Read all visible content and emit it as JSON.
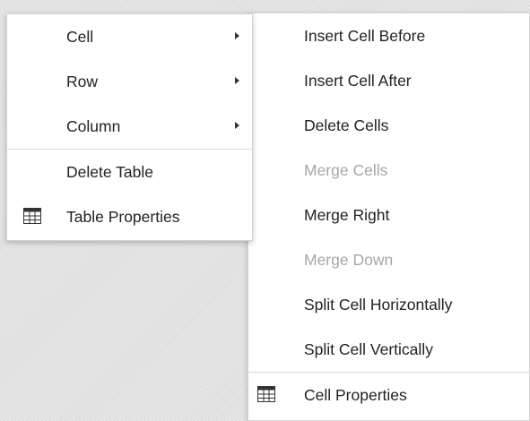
{
  "context_menu": {
    "items": [
      {
        "label": "Cell",
        "has_submenu": true
      },
      {
        "label": "Row",
        "has_submenu": true
      },
      {
        "label": "Column",
        "has_submenu": true
      },
      {
        "label": "Delete Table"
      },
      {
        "label": "Table Properties",
        "icon": "table-icon"
      }
    ]
  },
  "submenu": {
    "parent": "Cell",
    "items": [
      {
        "label": "Insert Cell Before",
        "enabled": true
      },
      {
        "label": "Insert Cell After",
        "enabled": true
      },
      {
        "label": "Delete Cells",
        "enabled": true
      },
      {
        "label": "Merge Cells",
        "enabled": false
      },
      {
        "label": "Merge Right",
        "enabled": true
      },
      {
        "label": "Merge Down",
        "enabled": false
      },
      {
        "label": "Split Cell Horizontally",
        "enabled": true
      },
      {
        "label": "Split Cell Vertically",
        "enabled": true
      },
      {
        "label": "Cell Properties",
        "enabled": true,
        "icon": "table-icon"
      }
    ]
  },
  "colors": {
    "text": "#222222",
    "disabled_text": "#a7a7a7",
    "menu_background": "#ffffff",
    "separator": "#d9d9d9"
  }
}
